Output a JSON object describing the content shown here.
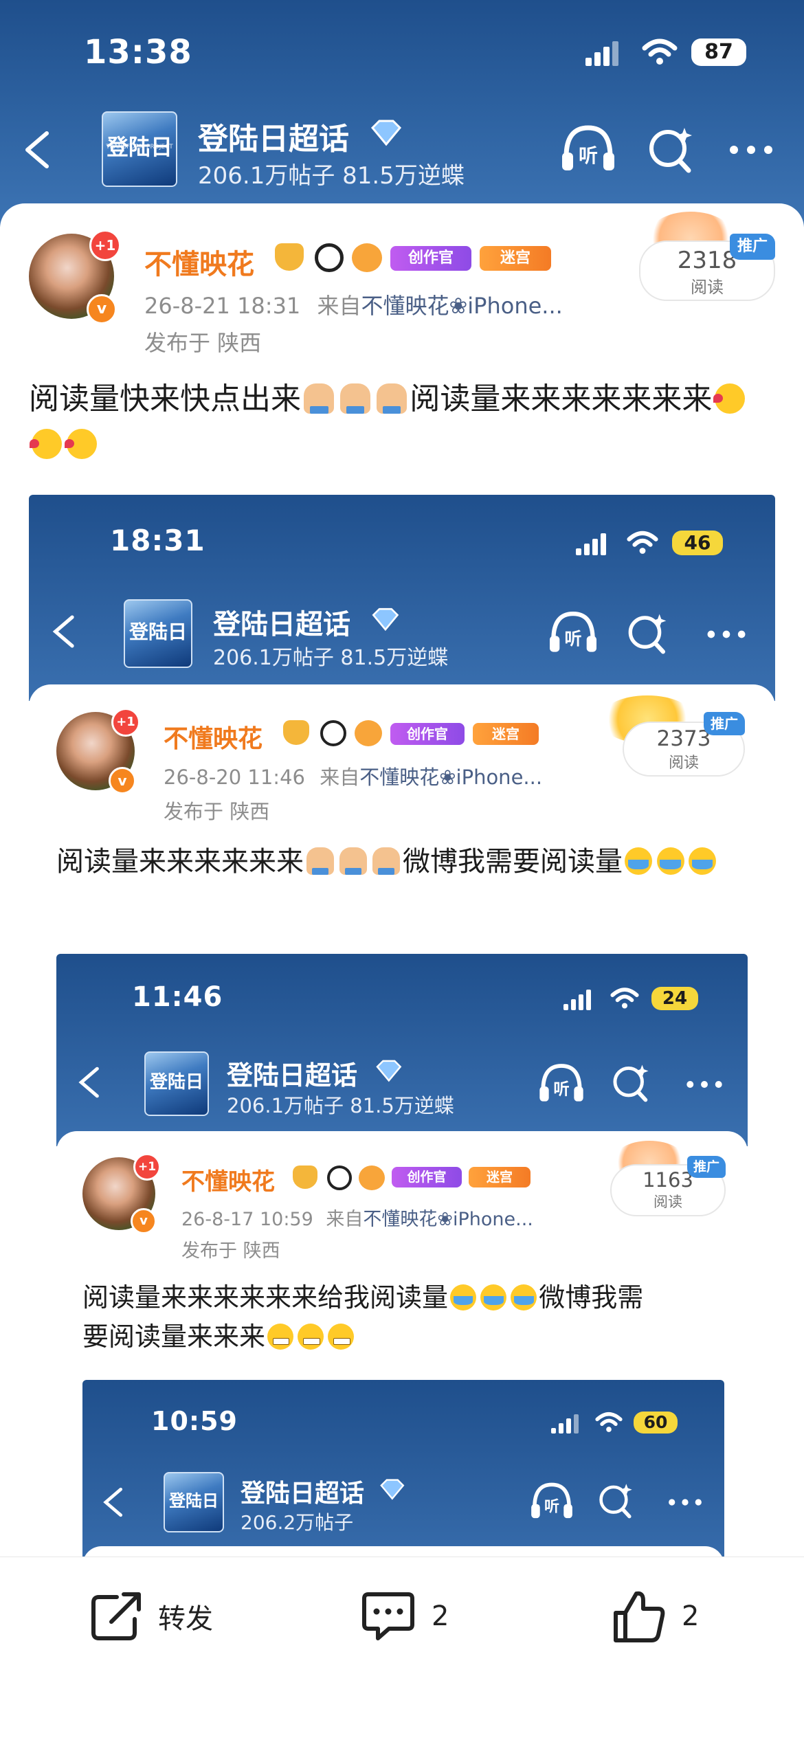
{
  "status_bar": {
    "time": "13:38",
    "battery": "87"
  },
  "topic": {
    "title": "登陆日超话",
    "stats": "206.1万帖子 81.5万逆蝶",
    "logo_text": "登陆日",
    "logo_sub": "TRANSFORM PROJECT"
  },
  "post": {
    "author": "不懂映花",
    "plus_badge": "+1",
    "tags": [
      "创作官",
      "迷宫"
    ],
    "time": "26-8-21 18:31",
    "source_prefix": "来自",
    "source": "不懂映花❀iPhone...",
    "location": "发布于 陕西",
    "reads": "2318",
    "reads_label": "阅读",
    "promo": "推广",
    "text_a": "阅读量快来快点出来",
    "text_b": "阅读量来来来来来来来"
  },
  "shot1": {
    "status_time": "18:31",
    "battery": "46",
    "topic_title": "登陆日超话",
    "topic_stats": "206.1万帖子 81.5万逆蝶",
    "author": "不懂映花",
    "time": "26-8-20 11:46",
    "source": "不懂映花❀iPhone...",
    "location": "发布于 陕西",
    "reads": "2373",
    "reads_label": "阅读",
    "promo": "推广",
    "text_a": "阅读量来来来来来来",
    "text_b": "微博我需要阅读量"
  },
  "shot2": {
    "status_time": "11:46",
    "battery": "24",
    "topic_title": "登陆日超话",
    "topic_stats": "206.1万帖子 81.5万逆蝶",
    "author": "不懂映花",
    "time": "26-8-17 10:59",
    "source": "不懂映花❀iPhone...",
    "location": "发布于 陕西",
    "reads": "1163",
    "reads_label": "阅读",
    "promo": "推广",
    "text_a": "阅读量来来来来来来给我阅读量",
    "text_b": "微博我需",
    "text_c": "要阅读量来来来"
  },
  "shot3": {
    "status_time": "10:59",
    "battery": "60",
    "topic_title": "登陆日超话",
    "topic_stats": "206.2万帖子"
  },
  "actions": {
    "repost_label": "转发",
    "comment_count": "2",
    "like_count": "2"
  },
  "colors": {
    "header_blue": "#2f64a3",
    "username_orange": "#f07a1e",
    "promo_blue": "#3a8de0"
  },
  "icons": [
    "back-icon",
    "listen-icon",
    "search-sparkle-icon",
    "more-icon",
    "repost-icon",
    "comment-icon",
    "like-icon"
  ]
}
